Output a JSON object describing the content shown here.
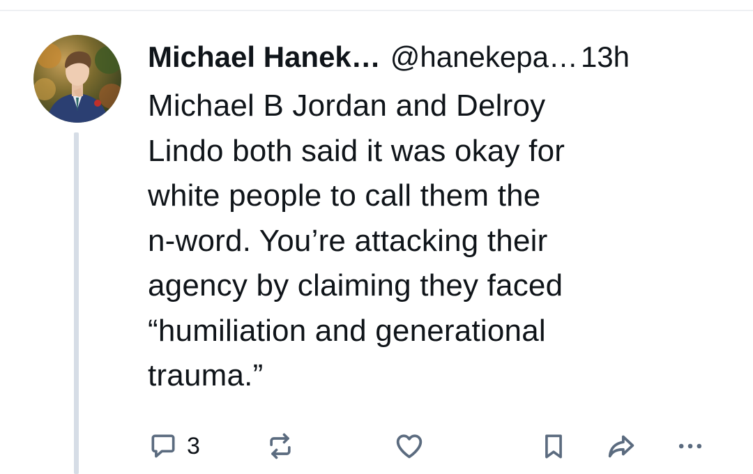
{
  "post": {
    "author": {
      "display_name": "Michael Hanek…",
      "handle": "@hanekepa…",
      "avatar_icon": "profile-photo"
    },
    "timestamp": "13h",
    "text": "Michael B Jordan and Delroy\nLindo both said it was okay for\nwhite people to call them the\nn-word. You’re attacking their\nagency by claiming they faced\n“humiliation and generational\ntrauma.”",
    "actions": {
      "reply": {
        "icon": "reply-icon",
        "count": "3"
      },
      "repost": {
        "icon": "repost-icon"
      },
      "like": {
        "icon": "heart-icon"
      },
      "bookmark": {
        "icon": "bookmark-icon"
      },
      "share": {
        "icon": "share-icon"
      },
      "more": {
        "icon": "more-icon"
      }
    }
  },
  "colors": {
    "text": "#0f1419",
    "icon": "#5b6b7f",
    "thread_line": "#d6dde6",
    "divider": "#eef0f3"
  }
}
